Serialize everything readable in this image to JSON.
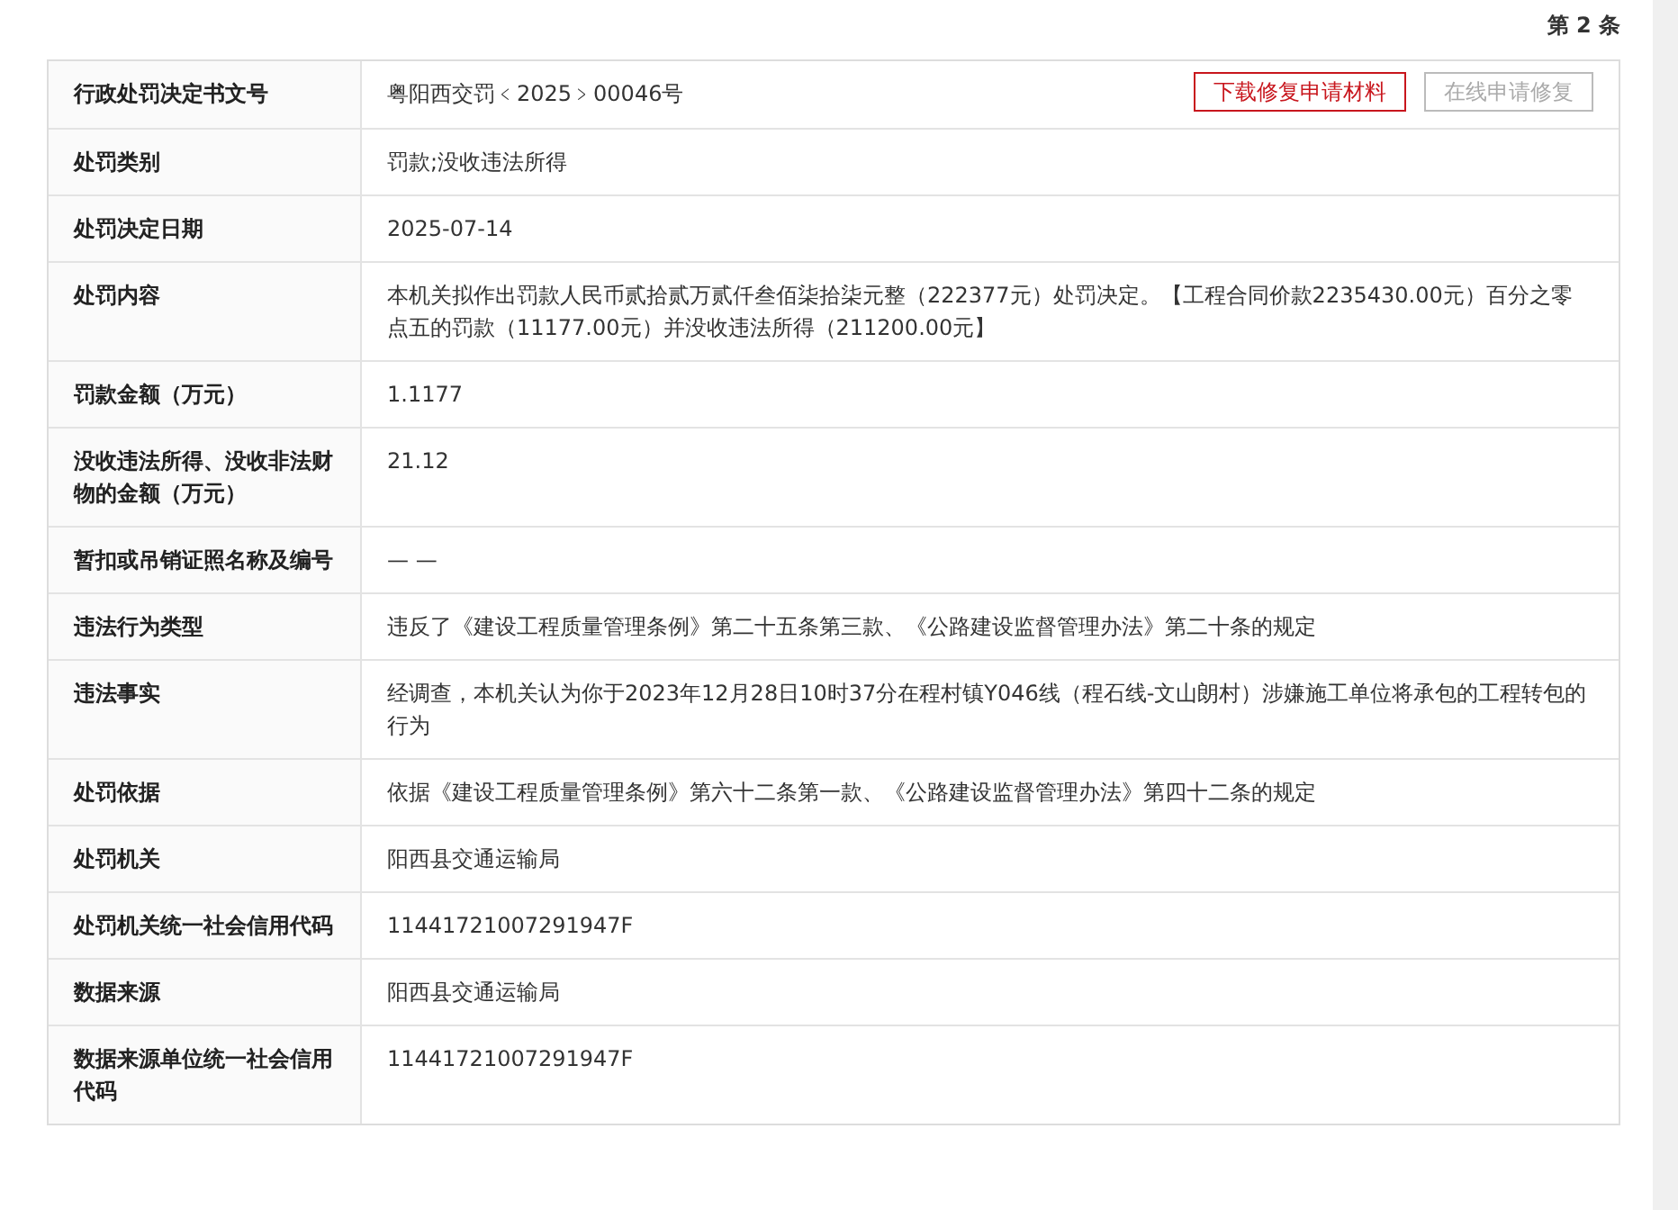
{
  "record_index": "第 2 条",
  "buttons": [
    {
      "label": "下载修复申请材料",
      "disabled": false
    },
    {
      "label": "在线申请修复",
      "disabled": true
    }
  ],
  "rows": [
    {
      "label": "行政处罚决定书文号",
      "value": "粤阳西交罚﹤2025﹥00046号"
    },
    {
      "label": "处罚类别",
      "value": "罚款;没收违法所得"
    },
    {
      "label": "处罚决定日期",
      "value": "2025-07-14"
    },
    {
      "label": "处罚内容",
      "value": "本机关拟作出罚款人民币贰拾贰万贰仟叁佰柒拾柒元整（222377元）处罚决定。【工程合同价款2235430.00元）百分之零点五的罚款（11177.00元）并没收违法所得（211200.00元】"
    },
    {
      "label": "罚款金额（万元）",
      "value": "1.1177"
    },
    {
      "label": "没收违法所得、没收非法财物的金额（万元）",
      "value": "21.12"
    },
    {
      "label": "暂扣或吊销证照名称及编号",
      "value": "— —"
    },
    {
      "label": "违法行为类型",
      "value": "违反了《建设工程质量管理条例》第二十五条第三款、《公路建设监督管理办法》第二十条的规定"
    },
    {
      "label": "违法事实",
      "value": "经调查，本机关认为你于2023年12月28日10时37分在程村镇Y046线（程石线-文山朗村）涉嫌施工单位将承包的工程转包的行为"
    },
    {
      "label": "处罚依据",
      "value": "依据《建设工程质量管理条例》第六十二条第一款、《公路建设监督管理办法》第四十二条的规定"
    },
    {
      "label": "处罚机关",
      "value": "阳西县交通运输局"
    },
    {
      "label": "处罚机关统一社会信用代码",
      "value": "11441721007291947F"
    },
    {
      "label": "数据来源",
      "value": "阳西县交通运输局"
    },
    {
      "label": "数据来源单位统一社会信用代码",
      "value": "11441721007291947F"
    }
  ]
}
